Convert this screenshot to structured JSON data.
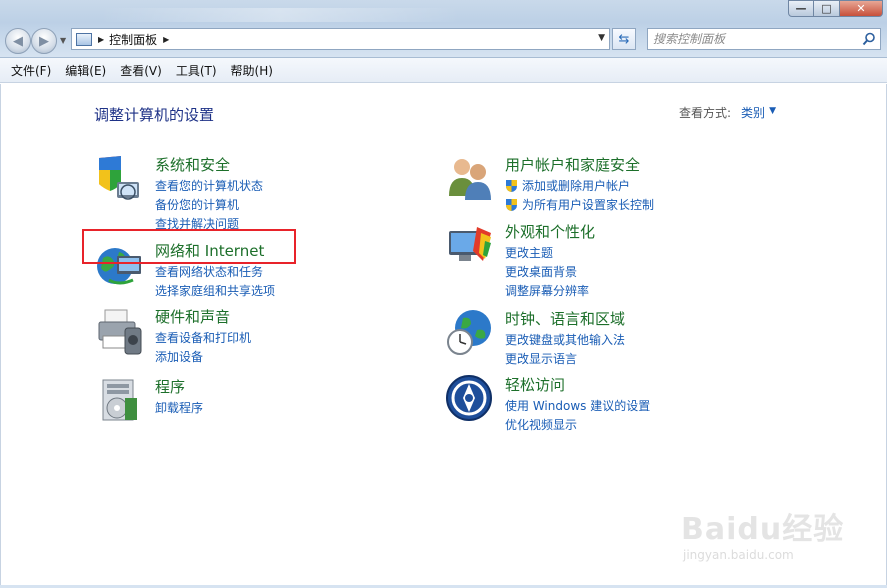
{
  "window": {
    "controls": {
      "minimize": "—",
      "maximize": "□",
      "close": "✕"
    }
  },
  "address": {
    "path_label": "控制面板"
  },
  "search": {
    "placeholder": "搜索控制面板"
  },
  "menubar": {
    "items": [
      "文件(F)",
      "编辑(E)",
      "查看(V)",
      "工具(T)",
      "帮助(H)"
    ]
  },
  "main": {
    "title": "调整计算机的设置",
    "view_by_label": "查看方式:",
    "view_by_value": "类别"
  },
  "categories": [
    {
      "title": "系统和安全",
      "icon": "shield-computer-icon",
      "links": [
        "查看您的计算机状态",
        "备份您的计算机",
        "查找并解决问题"
      ]
    },
    {
      "title": "网络和 Internet",
      "icon": "network-globe-icon",
      "links": [
        "查看网络状态和任务",
        "选择家庭组和共享选项"
      ]
    },
    {
      "title": "硬件和声音",
      "icon": "printer-icon",
      "links": [
        "查看设备和打印机",
        "添加设备"
      ]
    },
    {
      "title": "程序",
      "icon": "programs-icon",
      "links": [
        "卸载程序"
      ]
    },
    {
      "title": "用户帐户和家庭安全",
      "icon": "users-icon",
      "links": [
        "添加或删除用户帐户",
        "为所有用户设置家长控制"
      ]
    },
    {
      "title": "外观和个性化",
      "icon": "monitor-paint-icon",
      "links": [
        "更改主题",
        "更改桌面背景",
        "调整屏幕分辨率"
      ]
    },
    {
      "title": "时钟、语言和区域",
      "icon": "clock-globe-icon",
      "links": [
        "更改键盘或其他输入法",
        "更改显示语言"
      ]
    },
    {
      "title": "轻松访问",
      "icon": "ease-of-access-icon",
      "links": [
        "使用 Windows 建议的设置",
        "优化视频显示"
      ]
    }
  ],
  "watermark": {
    "main": "Baidu经验",
    "sub": "jingyan.baidu.com"
  },
  "colors": {
    "category_title": "#1c6f2a",
    "link": "#1a5db5",
    "page_title": "#1e3287",
    "highlight": "#e8232a"
  }
}
